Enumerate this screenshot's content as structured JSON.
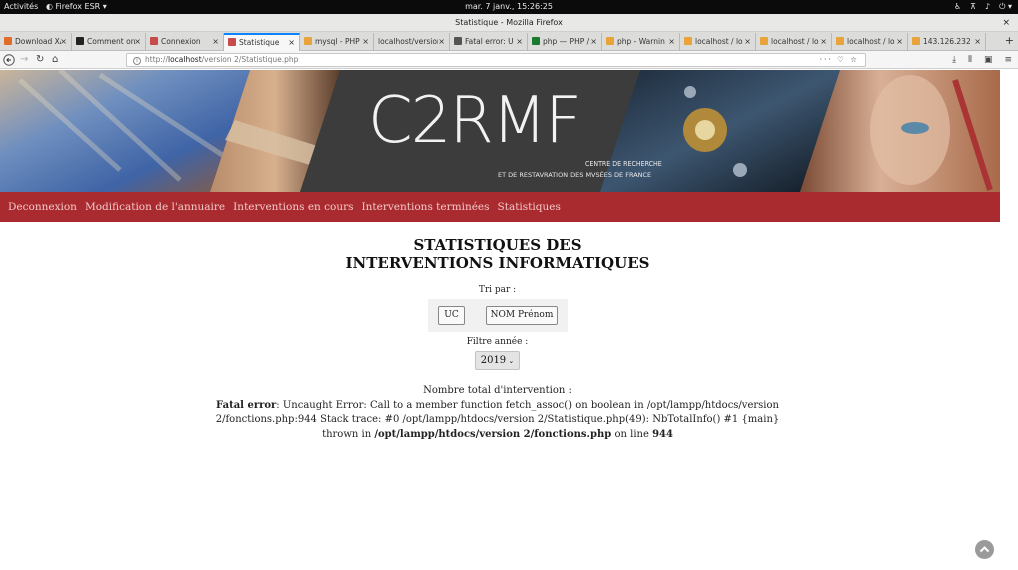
{
  "system_bar": {
    "activities": "Activités",
    "app": "Firefox ESR ▾",
    "clock": "mar.  7 janv., 15:26:25"
  },
  "window": {
    "title": "Statistique - Mozilla Firefox",
    "close": "×"
  },
  "tabs": [
    {
      "label": "Download XA",
      "favicon_color": "#e06b2a"
    },
    {
      "label": "Comment on",
      "favicon_color": "#222222"
    },
    {
      "label": "Connexion",
      "favicon_color": "#c74b4b"
    },
    {
      "label": "Statistique",
      "favicon_color": "#c74b4b",
      "active": true
    },
    {
      "label": "mysql - PHP",
      "favicon_color": "#e8a33a"
    },
    {
      "label": "localhost/version",
      "favicon_color": ""
    },
    {
      "label": "Fatal error: U",
      "favicon_color": "#555555"
    },
    {
      "label": "php — PHP /",
      "favicon_color": "#1a7a2e"
    },
    {
      "label": "php - Warnin",
      "favicon_color": "#e8a33a"
    },
    {
      "label": "localhost / lo",
      "favicon_color": "#e8a33a"
    },
    {
      "label": "localhost / lo",
      "favicon_color": "#e8a33a"
    },
    {
      "label": "localhost / lo",
      "favicon_color": "#e8a33a"
    },
    {
      "label": "143.126.232",
      "favicon_color": "#e8a33a"
    }
  ],
  "tab_close": "×",
  "new_tab": "+",
  "navbar": {
    "url_prefix": "http://",
    "url_host": "localhost",
    "url_path": "/version 2/Statistique.php",
    "url_actions": "··· ♡ ☆"
  },
  "banner": {
    "logo": "C2RMF",
    "subtitle_line1": "CENTRE DE RECHERCHE",
    "subtitle_line2": "ET DE RESTAVRATION DES MVSÉES DE FRANCE"
  },
  "menu": [
    "Deconnexion",
    "Modification de l'annuaire",
    "Interventions en cours",
    "Interventions terminées",
    "Statistiques"
  ],
  "page": {
    "title_line1": "STATISTIQUES DES",
    "title_line2": "INTERVENTIONS INFORMATIQUES",
    "sort_label": "Tri par :",
    "sort_uc": "UC",
    "sort_name": "NOM Prénom",
    "year_label": "Filtre année :",
    "year_value": "2019",
    "total_label": "Nombre total d'intervention :",
    "error_prefix": "Fatal error",
    "error_msg": ": Uncaught Error: Call to a member function fetch_assoc() on boolean in /opt/lampp/htdocs/version 2/fonctions.php:944 Stack trace: #0 /opt/lampp/htdocs/version 2/Statistique.php(49): NbTotalInfo() #1 {main} thrown in ",
    "error_file": "/opt/lampp/htdocs/version 2/fonctions.php",
    "error_on_line": " on line ",
    "error_line": "944"
  },
  "colors": {
    "menu_bg": "#a92b30",
    "menu_text": "#f3c9c9",
    "active_tab_accent": "#0a84ff"
  }
}
